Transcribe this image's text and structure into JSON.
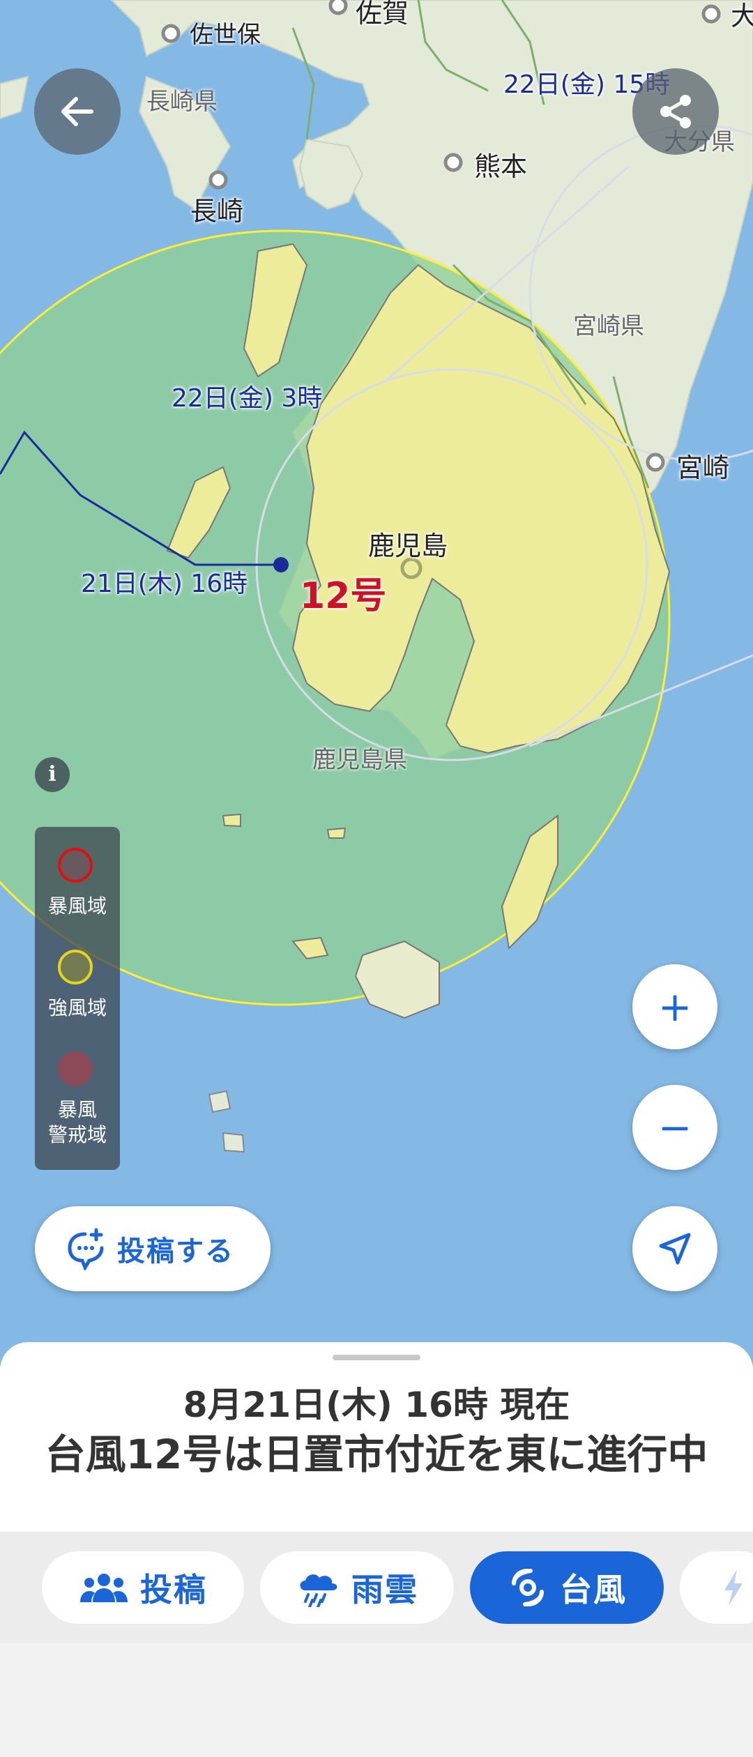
{
  "map": {
    "cities": [
      {
        "name": "佐世保"
      },
      {
        "name": "佐賀"
      },
      {
        "name": "熊本"
      },
      {
        "name": "長崎"
      },
      {
        "name": "宮崎"
      },
      {
        "name": "鹿児島"
      },
      {
        "name": "大"
      }
    ],
    "prefectures": [
      "長崎県",
      "大分県",
      "宮崎県",
      "鹿児島県"
    ],
    "forecast_times": [
      "22日(金) 15時",
      "22日(金) 3時",
      "21日(木) 16時"
    ],
    "typhoon_label": "12号",
    "colors": {
      "sea": "#84b9e6",
      "land": "#e3ead8",
      "strong_wind_fill": "#a5d2a6",
      "strong_wind_border": "#ffee33",
      "land_in_circle": "#ecec9a",
      "track": "#1a2a9a",
      "typhoon_label": "#d0102a",
      "accent": "#1a66d9"
    }
  },
  "buttons": {
    "back_icon": "arrow-left-icon",
    "share_icon": "share-icon",
    "info_icon": "info-icon",
    "zoom_in": "+",
    "zoom_out": "−",
    "location_icon": "navigation-arrow-icon"
  },
  "legend": {
    "items": [
      {
        "label": "暴風域",
        "color": "#e01010"
      },
      {
        "label": "強風域",
        "color": "#e3d51a"
      },
      {
        "label": "暴風\n警戒域",
        "color": "#9a4a5a"
      }
    ]
  },
  "post_button": {
    "label": "投稿する"
  },
  "status": {
    "datetime": "8月21日(木) 16時 現在",
    "message": "台風12号は日置市付近を東に進行中"
  },
  "tabs": [
    {
      "label": "投稿",
      "icon": "people-icon",
      "active": false
    },
    {
      "label": "雨雲",
      "icon": "rain-cloud-icon",
      "active": false
    },
    {
      "label": "台風",
      "icon": "typhoon-icon",
      "active": true
    },
    {
      "label": "",
      "icon": "lightning-icon",
      "active": false
    }
  ]
}
